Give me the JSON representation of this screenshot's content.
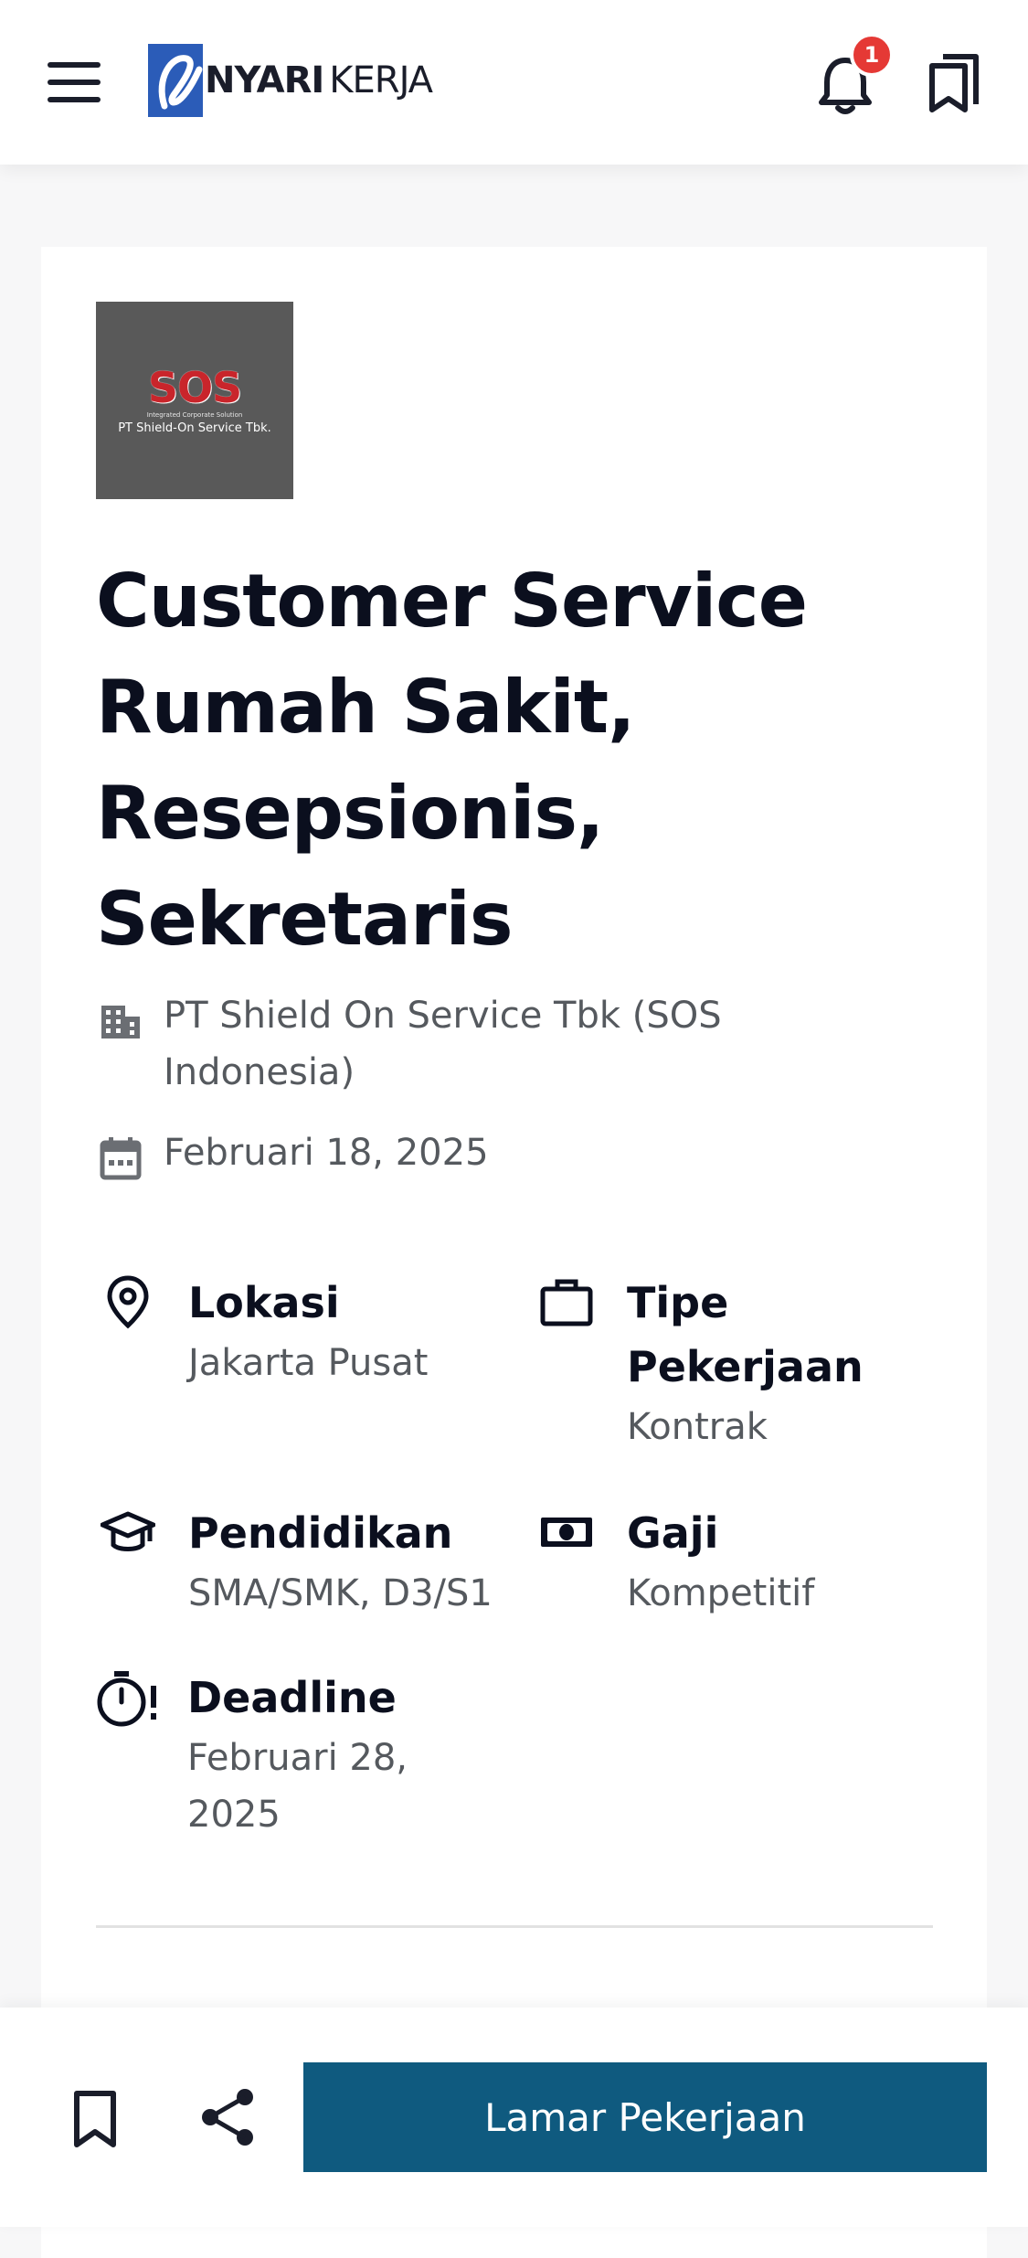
{
  "header": {
    "logo_text_bold": "NYARI",
    "logo_text_light": "KERJA",
    "notification_count": "1"
  },
  "job": {
    "company_logo_text": "SOS",
    "company_logo_tagline": "Integrated Corporate Solution",
    "company_logo_name": "PT Shield-On Service Tbk.",
    "title": "Customer Service Rumah Sakit, Resepsionis, Sekretaris",
    "company": "PT Shield On Service Tbk (SOS Indonesia)",
    "posted_date": "Februari 18, 2025",
    "details": {
      "location_label": "Lokasi",
      "location_value": "Jakarta Pusat",
      "type_label": "Tipe Pekerjaan",
      "type_value": "Kontrak",
      "education_label": "Pendidikan",
      "education_value": "SMA/SMK, D3/S1",
      "salary_label": "Gaji",
      "salary_value": "Kompetitif",
      "deadline_label": "Deadline",
      "deadline_value": "Februari 28, 2025"
    }
  },
  "bottom_bar": {
    "apply_label": "Lamar Pekerjaan"
  },
  "colors": {
    "primary": "#0f5a7f",
    "badge": "#e53935",
    "logo_blue": "#2b5cb8"
  }
}
